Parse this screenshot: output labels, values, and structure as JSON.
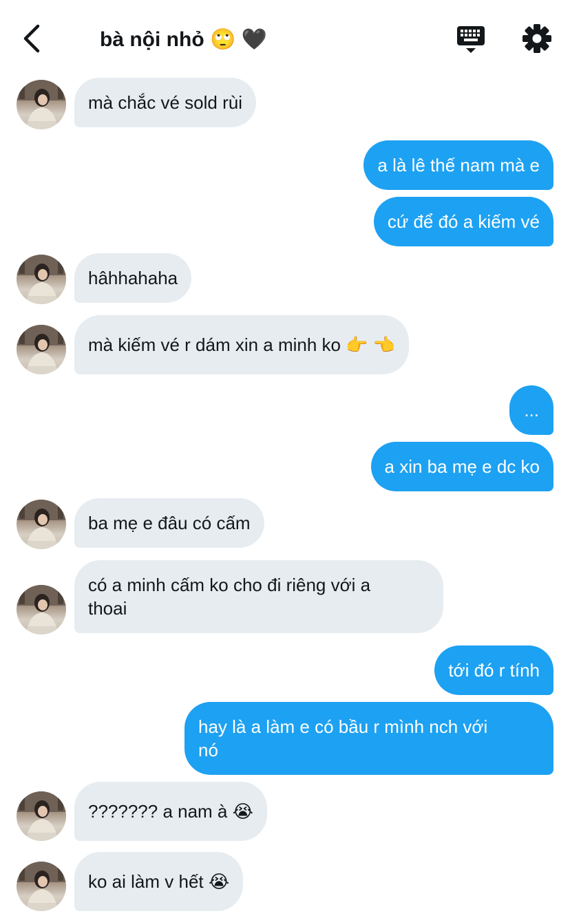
{
  "header": {
    "title": "bà nội nhỏ 🙄 🖤",
    "back_icon": "chevron-left-icon",
    "keyboard_icon": "keyboard-icon",
    "settings_icon": "gear-icon"
  },
  "colors": {
    "outgoing_bubble": "#1da1f2",
    "incoming_bubble": "#e6ecf0",
    "text": "#14171a"
  },
  "messages": [
    {
      "direction": "in",
      "text": "mà chắc vé sold rùi"
    },
    {
      "direction": "out",
      "text": "a là lê thế nam mà e"
    },
    {
      "direction": "out",
      "text": "cứ để đó a kiếm vé"
    },
    {
      "direction": "in",
      "text": "hâhhahaha"
    },
    {
      "direction": "in",
      "text": "mà kiếm vé r dám xin a minh ko 👉 👈"
    },
    {
      "direction": "out",
      "text": "..."
    },
    {
      "direction": "out",
      "text": "a xin ba mẹ e dc ko"
    },
    {
      "direction": "in",
      "text": "ba mẹ e đâu có cấm"
    },
    {
      "direction": "in",
      "text": "có a minh cấm ko cho đi riêng với a",
      "text2": "thoai"
    },
    {
      "direction": "out",
      "text": "tới đó r tính"
    },
    {
      "direction": "out",
      "text": "hay là a làm e có bầu r mình nch với",
      "text2": "nó"
    },
    {
      "direction": "in",
      "text": "??????? a nam à 😭"
    },
    {
      "direction": "in",
      "text": "ko ai làm v hết 😭"
    }
  ]
}
